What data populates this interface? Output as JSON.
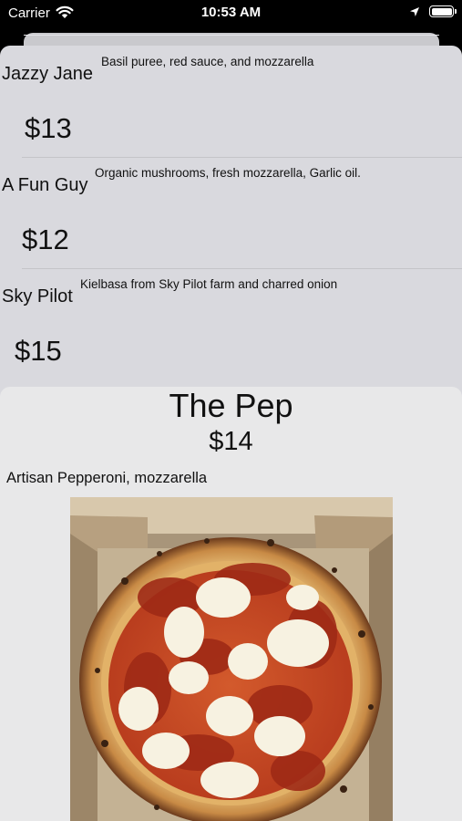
{
  "status_bar": {
    "carrier": "Carrier",
    "time": "10:53 AM"
  },
  "menu": {
    "items": [
      {
        "name": "Jazzy Jane",
        "description": "Basil puree, red sauce, and mozzarella",
        "price": "$13"
      },
      {
        "name": "A Fun Guy",
        "description": "Organic mushrooms, fresh mozzarella, Garlic oil.",
        "price": "$12"
      },
      {
        "name": "Sky Pilot",
        "description": "Kielbasa from Sky Pilot farm and charred onion",
        "price": "$15"
      }
    ]
  },
  "detail": {
    "name": "The Pep",
    "price": "$14",
    "description": "Artisan Pepperoni, mozzarella",
    "photo_icon": "pepperoni-pizza-photo"
  },
  "colors": {
    "list_background": "#d9d9de",
    "detail_background": "#e8e8e9",
    "status_bar_background": "#000000"
  }
}
